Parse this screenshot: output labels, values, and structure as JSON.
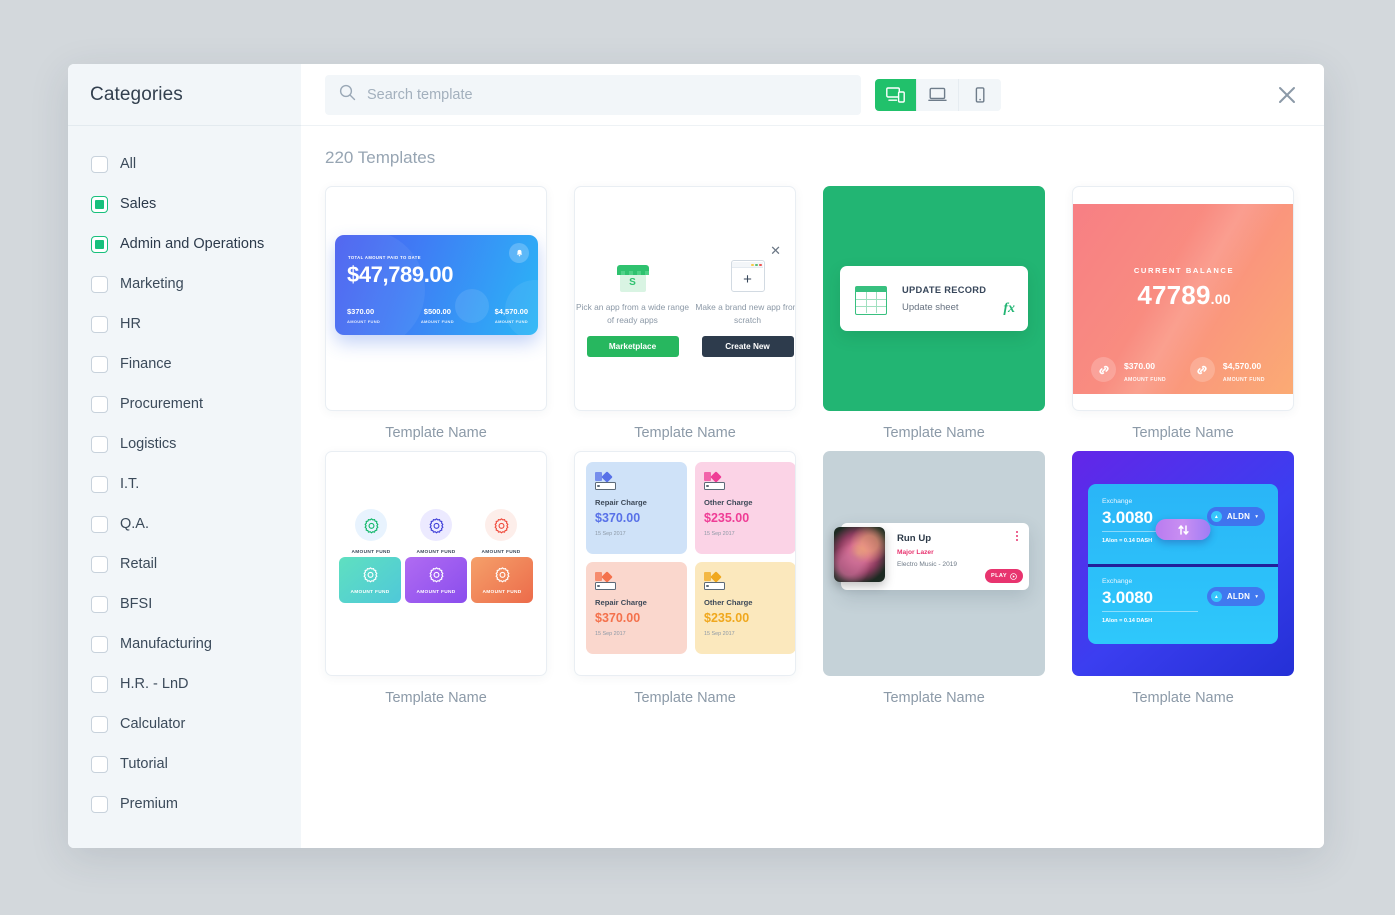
{
  "sidebar": {
    "title": "Categories",
    "items": [
      {
        "label": "All",
        "checked": false
      },
      {
        "label": "Sales",
        "checked": true
      },
      {
        "label": "Admin and Operations",
        "checked": true
      },
      {
        "label": "Marketing",
        "checked": false
      },
      {
        "label": "HR",
        "checked": false
      },
      {
        "label": "Finance",
        "checked": false
      },
      {
        "label": "Procurement",
        "checked": false
      },
      {
        "label": "Logistics",
        "checked": false
      },
      {
        "label": "I.T.",
        "checked": false
      },
      {
        "label": "Q.A.",
        "checked": false
      },
      {
        "label": "Retail",
        "checked": false
      },
      {
        "label": "BFSI",
        "checked": false
      },
      {
        "label": "Manufacturing",
        "checked": false
      },
      {
        "label": "H.R. - LnD",
        "checked": false
      },
      {
        "label": "Calculator",
        "checked": false
      },
      {
        "label": "Tutorial",
        "checked": false
      },
      {
        "label": "Premium",
        "checked": false
      }
    ]
  },
  "topbar": {
    "search_placeholder": "Search template",
    "search_value": "",
    "search_icon": "search-icon",
    "close_icon": "close-icon",
    "views": [
      {
        "name": "responsive-view",
        "icon": "desktop-mobile-icon",
        "active": true
      },
      {
        "name": "desktop-view",
        "icon": "laptop-icon",
        "active": false
      },
      {
        "name": "mobile-view",
        "icon": "phone-icon",
        "active": false
      }
    ]
  },
  "content": {
    "count_label": "220 Templates",
    "template_name": "Template Name"
  },
  "colors": {
    "accent_green": "#21c16b",
    "checkbox_green": "#17c07c",
    "pink": "#e8346f",
    "page_bg": "#d3d8dc",
    "sidebar_bg": "#f2f6f9"
  },
  "cards": {
    "balance_blue": {
      "label": "TOTAL AMOUNT PAID TO DATE",
      "amount": "$47,789.00",
      "bell_icon": "bell-icon",
      "stats": [
        {
          "value": "$370.00",
          "caption": "AMOUNT FUND"
        },
        {
          "value": "$500.00",
          "caption": "AMOUNT FUND"
        },
        {
          "value": "$4,570.00",
          "caption": "AMOUNT FUND"
        }
      ]
    },
    "app_picker": {
      "close_icon": "close-icon",
      "options": [
        {
          "icon": "storefront-icon",
          "desc": "Pick an app from a wide range of ready apps",
          "button": "Marketplace"
        },
        {
          "icon": "new-window-plus-icon",
          "desc": "Make a brand new app from scratch",
          "button": "Create New"
        }
      ]
    },
    "update_record": {
      "icon": "spreadsheet-icon",
      "title": "UPDATE RECORD",
      "subtitle": "Update sheet",
      "formula_icon": "fx"
    },
    "current_balance": {
      "label": "CURRENT BALANCE",
      "amount_main": "47789",
      "amount_cents": ".00",
      "stats": [
        {
          "icon": "link-icon",
          "value": "$370.00",
          "caption": "AMOUNT FUND"
        },
        {
          "icon": "link-icon",
          "value": "$4,570.00",
          "caption": "AMOUNT FUND"
        }
      ]
    },
    "gear_grid": {
      "top": [
        {
          "icon": "gear-icon",
          "caption": "AMOUNT FUND",
          "bubble": "#e8f3fe",
          "gear": "#12b76a"
        },
        {
          "icon": "gear-icon",
          "caption": "AMOUNT FUND",
          "bubble": "#eceaff",
          "gear": "#3f3fd8"
        },
        {
          "icon": "gear-icon",
          "caption": "AMOUNT FUND",
          "bubble": "#fdeeea",
          "gear": "#ef4b3c"
        }
      ],
      "bottom": [
        {
          "icon": "gear-icon",
          "caption": "AMOUNT FUND",
          "grad": "linear-gradient(140deg,#5fe0c0,#4fc8d9)"
        },
        {
          "icon": "gear-icon",
          "caption": "AMOUNT FUND",
          "grad": "linear-gradient(140deg,#b06bf2,#8a4ded)"
        },
        {
          "icon": "gear-icon",
          "caption": "AMOUNT FUND",
          "grad": "linear-gradient(140deg,#f5a06a,#ec6b4a)"
        }
      ]
    },
    "charges": {
      "tiles": [
        {
          "icon": "color-swatch-icon",
          "title": "Repair Charge",
          "amount": "$370.00",
          "date": "15 Sep 2017",
          "bg": "#cfe2f8",
          "fg": "#5871e8"
        },
        {
          "icon": "color-swatch-icon",
          "title": "Other Charge",
          "amount": "$235.00",
          "date": "15 Sep 2017",
          "bg": "#fbd3e6",
          "fg": "#ef3d96"
        },
        {
          "icon": "color-swatch-icon",
          "title": "Repair Charge",
          "amount": "$370.00",
          "date": "15 Sep 2017",
          "bg": "#fad7cd",
          "fg": "#f4714c"
        },
        {
          "icon": "color-swatch-icon",
          "title": "Other Charge",
          "amount": "$235.00",
          "date": "15 Sep 2017",
          "bg": "#fbe8bd",
          "fg": "#f0a81e"
        }
      ]
    },
    "music": {
      "album_art": "flower-photo",
      "title": "Run Up",
      "artist": "Major Lazer",
      "album": "Electro Music - 2019",
      "menu_icon": "vertical-dots-icon",
      "play_label": "PLAY",
      "play_icon": "play-circle-icon"
    },
    "exchange": {
      "rows": [
        {
          "label": "Exchange",
          "value": "3.0080",
          "rate": "1Alon = 0.14 DASH",
          "currency": "ALDN",
          "chevron_icon": "chevron-down-icon",
          "coin_icon": "coin-icon"
        },
        {
          "label": "Exchange",
          "value": "3.0080",
          "rate": "1Alon = 0.14 DASH",
          "currency": "ALDN",
          "chevron_icon": "chevron-down-icon",
          "coin_icon": "coin-icon"
        }
      ],
      "swap_icon": "swap-arrows-icon"
    }
  }
}
